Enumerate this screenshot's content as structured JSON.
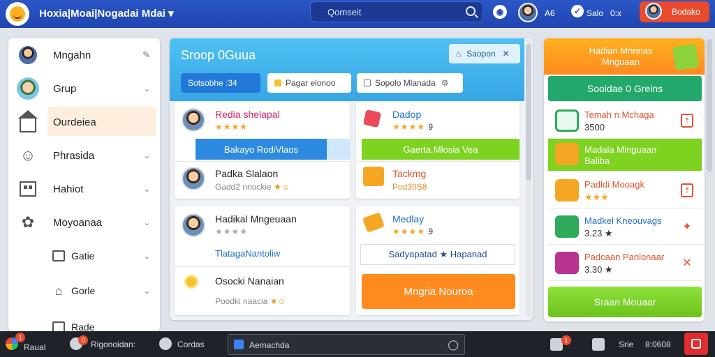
{
  "topbar": {
    "title": "Hoxia|Moai|Nogadai Mdai",
    "title_chevron": "▾",
    "search_placeholder": "Qomseit",
    "chat_label": "A6",
    "status_label": "Salo",
    "status_value": "0:x",
    "user_button": "Bodako"
  },
  "sidebar": {
    "items": [
      {
        "label": "Mngahn",
        "icon": "user-avatar",
        "action": "✎"
      },
      {
        "label": "Grup",
        "icon": "group-avatar",
        "chevron": "⌄"
      },
      {
        "label": "Ourdeiea",
        "icon": "home-icon"
      },
      {
        "label": "Phrasida",
        "icon": "bot-icon",
        "chevron": "⌄"
      },
      {
        "label": "Hahiot",
        "icon": "building-icon",
        "chevron": "⌄"
      },
      {
        "label": "Moyoanaa",
        "icon": "puzzle-icon",
        "chevron": "⌄"
      },
      {
        "label": "Gatie",
        "icon": "document-icon",
        "chevron": "⌄"
      },
      {
        "label": "Gorle",
        "icon": "tag-icon",
        "chevron": "⌄"
      },
      {
        "label": "Rade",
        "icon": "document-icon"
      }
    ]
  },
  "main": {
    "title": "Sroop 0Guua",
    "sapon_button": "Saopon",
    "close": "✕",
    "filters": [
      "Sotsobhe :34",
      "Pagar elonoo",
      "Sopolo Mlanada"
    ],
    "cards": [
      {
        "name": "Redia shelapal",
        "stars": "★★★★",
        "bar": "Bakayo RodiVlaos"
      },
      {
        "name": "Dadop",
        "stars": "★★★★",
        "rating": "9",
        "bar": "Gaerta Mlosia Vea"
      },
      {
        "name": "Padka Slalaon",
        "note": "Gadd2 nnockie"
      },
      {
        "name": "Tackmg",
        "note": "Pod30S8"
      },
      {
        "name": "Hadikal Mngeuaan",
        "stars": "★★★★",
        "bar": "TlatagaNantoliw"
      },
      {
        "name": "Medlay",
        "stars": "★★★★",
        "rating": "9",
        "bar": "Sadyapatad ★ Hapanad"
      },
      {
        "name": "Osocki Nanaian",
        "note": "Poodki naacia"
      },
      {
        "name": "Mngria Nouroa",
        "bar": "Mngria Nouroa"
      }
    ]
  },
  "right": {
    "header": "Hadian Mnrinas\nMnguaan",
    "green_button": "Sooidae 0 Greins",
    "rows": [
      {
        "title": "Temah n Mchaga",
        "value": "3500"
      },
      {
        "title": "Madala Minguaan",
        "value": "Baliba"
      },
      {
        "title": "Padldi Mooagk",
        "value": "★★★"
      },
      {
        "title": "Madkel Kneouvags",
        "value": "3.23 ★"
      },
      {
        "title": "Padcaan Panlonaar",
        "value": "3.30 ★"
      }
    ],
    "footer_button": "Sraan Mouaar"
  },
  "taskbar": {
    "start_label": "Raual",
    "start_badge": "1",
    "app1": "Rigonoidan:",
    "app1_badge": "0",
    "app2": "Cordas",
    "address": "Aemachda",
    "tray_badge": "1",
    "status": "Srie",
    "time": "8:0608"
  },
  "colors": {
    "topbar": "#1f45b0",
    "accent_blue": "#38a6e6",
    "green": "#7ed321",
    "orange": "#ff8a1f",
    "red": "#e94b2c"
  }
}
